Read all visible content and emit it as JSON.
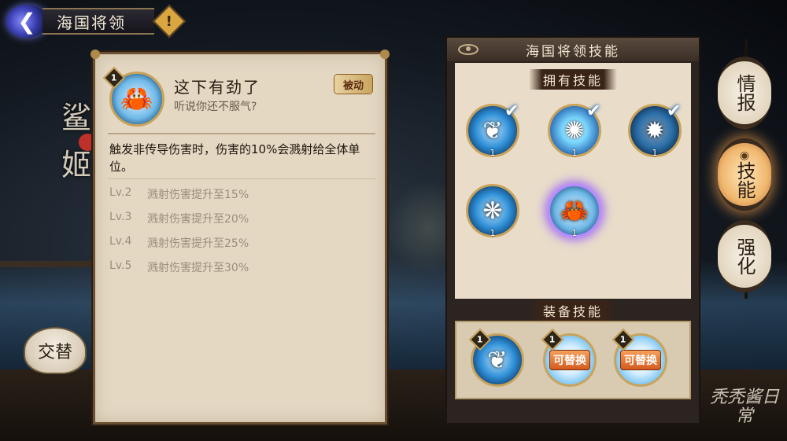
{
  "title_bar": {
    "title": "海国将领",
    "info_icon": "!"
  },
  "side_calligraphy": "鲨姬",
  "switch_button": {
    "label": "交替"
  },
  "skill_detail": {
    "level": "1",
    "name": "这下有劲了",
    "quote": "听说你还不服气?",
    "tag": "被动",
    "description": "触发非传导伤害时，伤害的10%会溅射给全体单位。",
    "levels": [
      {
        "lv": "Lv.2",
        "text": "溅射伤害提升至15%"
      },
      {
        "lv": "Lv.3",
        "text": "溅射伤害提升至20%"
      },
      {
        "lv": "Lv.4",
        "text": "溅射伤害提升至25%"
      },
      {
        "lv": "Lv.5",
        "text": "溅射伤害提升至30%"
      }
    ]
  },
  "skills_panel": {
    "header": "海国将领技能",
    "owned_title": "拥有技能",
    "owned": [
      {
        "icon": "claw-skill-icon",
        "glyph": "❦",
        "num": "1",
        "checked": true
      },
      {
        "icon": "electric-burst-icon",
        "glyph": "✺",
        "num": "1",
        "checked": true
      },
      {
        "icon": "spiky-shell-icon",
        "glyph": "✹",
        "num": "1",
        "checked": true
      },
      {
        "icon": "splash-crab-icon",
        "glyph": "❋",
        "num": "1",
        "checked": false
      },
      {
        "icon": "crab-icon",
        "glyph": "🦀",
        "num": "1",
        "checked": false
      }
    ],
    "equip_title": "装备技能",
    "equipped": [
      {
        "level": "1",
        "type": "skill",
        "glyph": "❦"
      },
      {
        "level": "1",
        "type": "replace",
        "label": "可替换"
      },
      {
        "level": "1",
        "type": "replace",
        "label": "可替换"
      }
    ]
  },
  "tabs": [
    {
      "label": "情报",
      "active": false
    },
    {
      "label": "技能",
      "active": true
    },
    {
      "label": "强化",
      "active": false
    }
  ],
  "watermark": "秃秃酱日常"
}
